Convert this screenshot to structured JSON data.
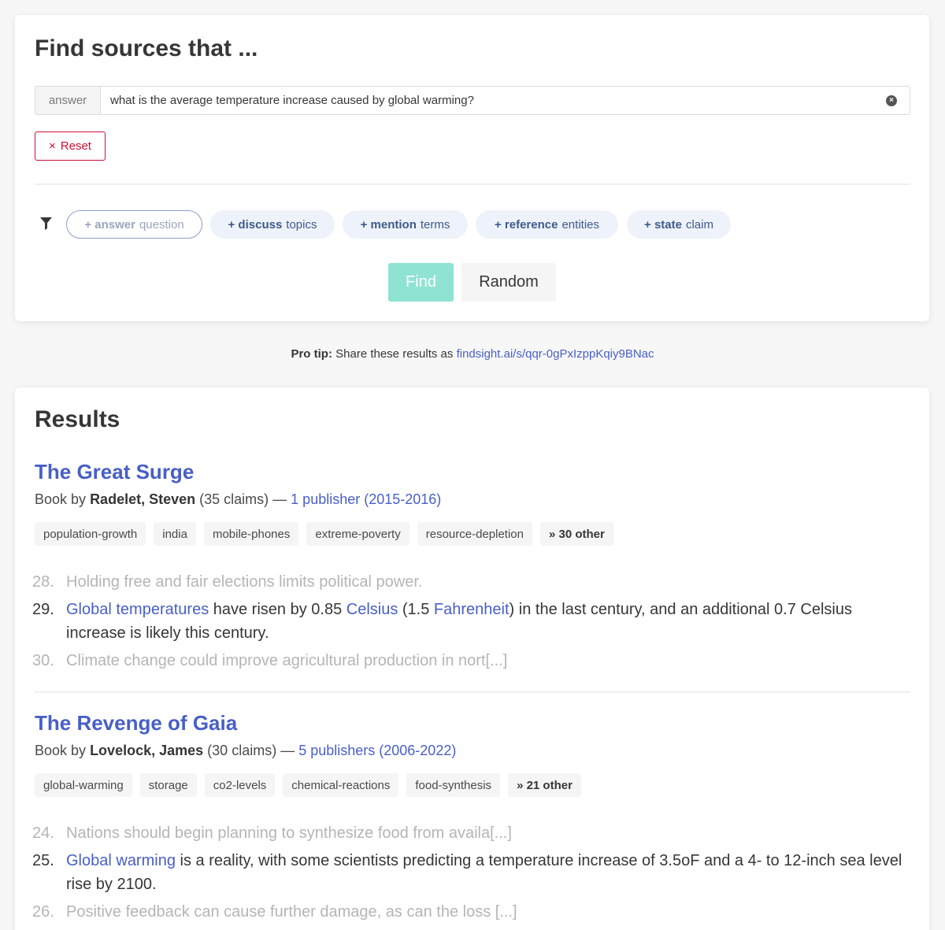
{
  "search": {
    "title": "Find sources that ...",
    "addon_label": "answer",
    "query_value": "what is the average temperature increase caused by global warming?",
    "reset_label": "Reset",
    "reset_icon": "×",
    "chips": [
      {
        "bold": "+ answer",
        "rest": "question"
      },
      {
        "bold": "+ discuss",
        "rest": "topics"
      },
      {
        "bold": "+ mention",
        "rest": "terms"
      },
      {
        "bold": "+ reference",
        "rest": "entities"
      },
      {
        "bold": "+ state",
        "rest": "claim"
      }
    ],
    "find_label": "Find",
    "random_label": "Random"
  },
  "pro_tip": {
    "label": "Pro tip:",
    "text": "Share these results as",
    "link": "findsight.ai/s/qqr-0gPxIzppKqiy9BNac"
  },
  "results": {
    "title": "Results",
    "items": [
      {
        "title": "The Great Surge",
        "type": "Book by",
        "author": "Radelet, Steven",
        "claims": "(35 claims) —",
        "publishers": "1 publisher (2015-2016)",
        "tags": [
          "population-growth",
          "india",
          "mobile-phones",
          "extreme-poverty",
          "resource-depletion"
        ],
        "more_tags": "» 30 other",
        "claim_list": [
          {
            "num": "28.",
            "text": "Holding free and fair elections limits political power."
          },
          {
            "num": "29.",
            "l1": "Global temperatures",
            "t1": " have risen by 0.85 ",
            "l2": "Celsius",
            "t2": " (1.5 ",
            "l3": "Fahrenheit",
            "t3": ") in the last century, and an additional 0.7 Celsius increase is likely this century."
          },
          {
            "num": "30.",
            "text": "Climate change could improve agricultural production in nort[...]"
          }
        ]
      },
      {
        "title": "The Revenge of Gaia",
        "type": "Book by",
        "author": "Lovelock, James",
        "claims": "(30 claims) —",
        "publishers": "5 publishers (2006-2022)",
        "tags": [
          "global-warming",
          "storage",
          "co2-levels",
          "chemical-reactions",
          "food-synthesis"
        ],
        "more_tags": "» 21 other",
        "claim_list": [
          {
            "num": "24.",
            "text": "Nations should begin planning to synthesize food from availa[...]"
          },
          {
            "num": "25.",
            "l1": "Global warming",
            "t1": " is a reality, with some scientists predicting a temperature increase of 3.5oF and a 4- to 12-inch sea level rise by 2100."
          },
          {
            "num": "26.",
            "text": "Positive feedback can cause further damage, as can the loss [...]"
          }
        ]
      }
    ]
  }
}
